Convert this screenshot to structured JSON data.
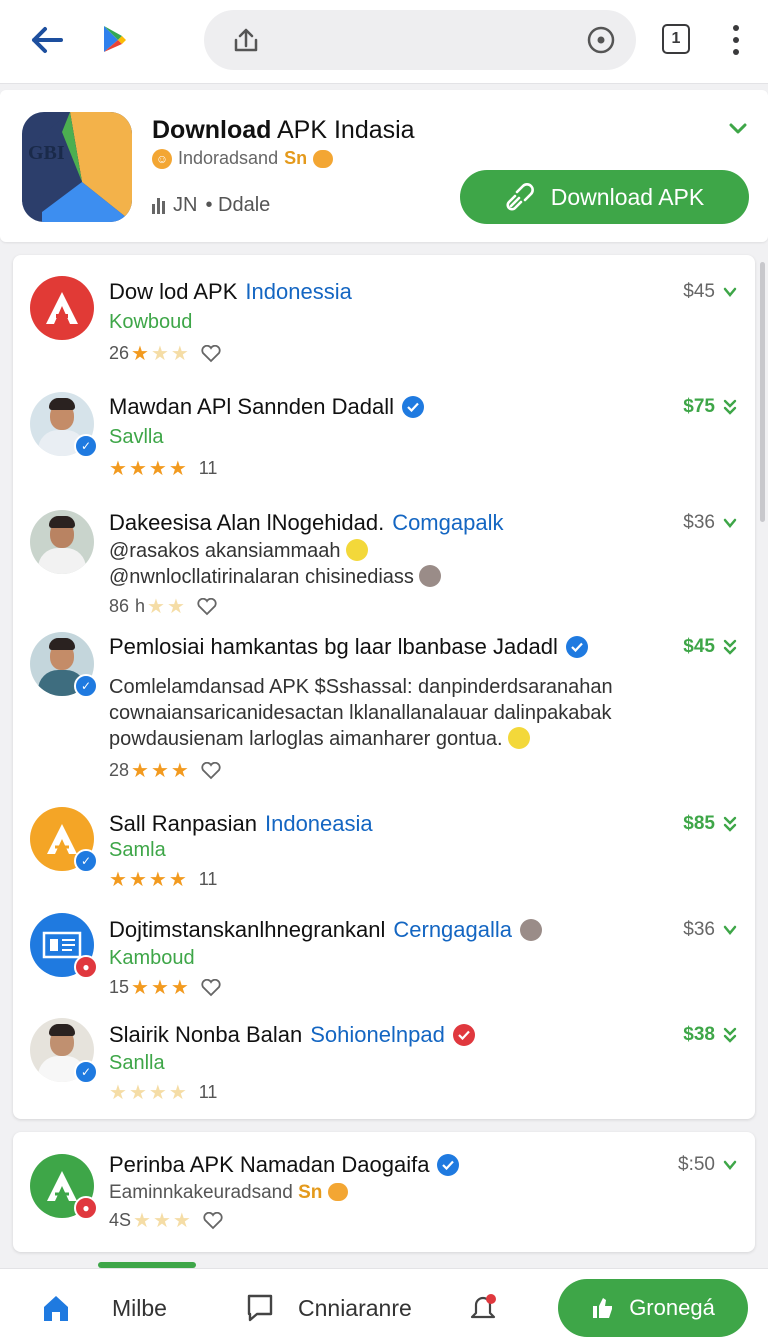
{
  "browser": {
    "tab_count": "1"
  },
  "app": {
    "title_bold": "Download",
    "title_rest": " APK Indasia",
    "icon_text": "GBI",
    "developer": "Indoradsand",
    "developer_suffix": "Sn",
    "stats_count": "JN",
    "stats_label": "• Ddale",
    "download_label": "Download APK",
    "accent_color": "#3ea648"
  },
  "items": [
    {
      "name": "Dow lod APK",
      "link": "Indonessia",
      "sub": "Kowboud",
      "rating_count": "26",
      "price": "$45",
      "price_style": "gray",
      "icon": "red-arrow-logo-icon"
    },
    {
      "name": "Mawdan APl Sannden Dadall",
      "sub": "Savlla",
      "rating_count": "11",
      "price": "$75",
      "price_style": "green",
      "icon": "person-avatar-icon"
    },
    {
      "name": "Dakeesisa Alan lNogehidad.",
      "link": "Comgapalk",
      "line1": "@rasakos akansiammaah",
      "line2": "@nwnlocllatirinalaran chisinediass",
      "rating_count": "86",
      "rating_prefix": "h",
      "price": "$36",
      "price_style": "gray",
      "icon": "person-avatar-icon"
    },
    {
      "name": "Pemlosiai hamkantas  bg laar lbanbase Jadadl",
      "line1": "Comlelamdansad APK $Sshassal: danpinderdsaranahan",
      "line2": "cownaiansaricanidesactan lklanallanalauar dalinpakabak",
      "line3": "powdausienam larloglas aimanharer gontua.",
      "rating_count": "28",
      "price": "$45",
      "price_style": "green",
      "icon": "person-avatar-icon"
    },
    {
      "name": "Sall Ranpasian",
      "link": "Indoneasia",
      "sub": "Samla",
      "rating_count": "11",
      "price": "$85",
      "price_style": "green",
      "icon": "orange-a-logo-icon"
    },
    {
      "name": "Dojtimstanskanlhnegrankanl",
      "link": "Cerngagalla",
      "sub": "Kamboud",
      "rating_count": "15",
      "price": "$36",
      "price_style": "gray",
      "icon": "blue-id-logo-icon"
    },
    {
      "name": "Slairik Nonba Balan",
      "link": "Sohionelnpad",
      "sub": "Sanlla",
      "rating_count": "11",
      "price": "$38",
      "price_style": "green",
      "icon": "person-avatar-icon"
    }
  ],
  "bottom_item": {
    "name": "Perinba APK Namadan Daogaifa",
    "sub": "Eaminnkakeuradsand",
    "sub_suffix": "Sn",
    "rating_count": "4S",
    "price": "$:50",
    "price_style": "gray",
    "icon": "green-a-logo-icon"
  },
  "nav": {
    "home_label": "Milbe",
    "chat_label": "Cnniaranre",
    "cta_label": "Gronegá"
  }
}
